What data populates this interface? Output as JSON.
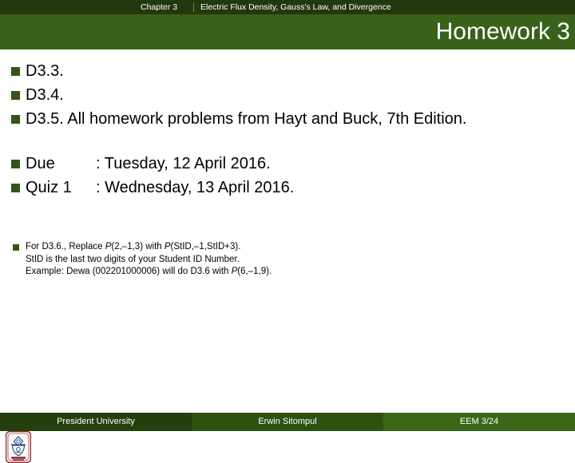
{
  "header": {
    "chapter_number": "Chapter 3",
    "chapter_title": "Electric Flux Density, Gauss's Law, and Divergence",
    "slide_title": "Homework 3"
  },
  "colors": {
    "chapter_bar": "#24380d",
    "title_band": "#39611a",
    "bullet_square": "#33541a",
    "footer_left": "#24400d",
    "footer_mid": "#2d5210",
    "footer_right": "#3b6818",
    "text": "#000000"
  },
  "body": {
    "bullets": [
      {
        "text": "D3.3."
      },
      {
        "text": "D3.4."
      },
      {
        "text": "D3.5. All homework problems from Hayt and Buck, 7th Edition."
      }
    ],
    "schedule": [
      {
        "label": "Due",
        "value": ": Tuesday, 12 April 2016."
      },
      {
        "label": "Quiz 1",
        "value": ": Wednesday, 13 April 2016."
      }
    ],
    "note": {
      "line1_a": "For D3.6., Replace ",
      "line1_p1": "P",
      "line1_b": "(2,–1,3) with ",
      "line1_p2": "P",
      "line1_c": "(StID,–1,StID+3).",
      "line2": "StID is the last two digits of your Student ID Number.",
      "line3_a": "Example: Dewa (002201000006) will do D3.6 with ",
      "line3_p": "P",
      "line3_b": "(6,–1,9)."
    }
  },
  "footer": {
    "left": "President University",
    "middle": "Erwin Sitompul",
    "right": "EEM 3/24"
  },
  "logo": {
    "name": "president-university-crest"
  }
}
